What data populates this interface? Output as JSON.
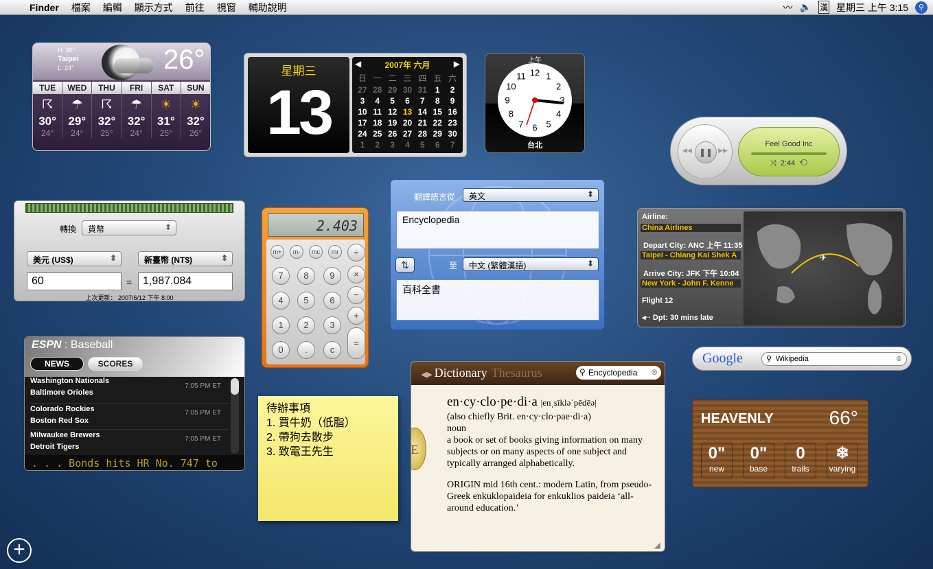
{
  "menubar": {
    "apple": "",
    "app": "Finder",
    "items": [
      "檔案",
      "編輯",
      "顯示方式",
      "前往",
      "視窗",
      "輔助說明"
    ],
    "ime": "漢",
    "clock": "星期三 上午 3:15"
  },
  "weather": {
    "high": "H: 30°",
    "city": "Taipei",
    "low": "L: 24°",
    "temp": "26°",
    "days": [
      {
        "name": "TUE",
        "hi": "30°",
        "lo": "24°",
        "icon": "thunderstorm-icon"
      },
      {
        "name": "WED",
        "hi": "29°",
        "lo": "24°",
        "icon": "rain-icon"
      },
      {
        "name": "THU",
        "hi": "32°",
        "lo": "25°",
        "icon": "thunderstorm-icon"
      },
      {
        "name": "FRI",
        "hi": "32°",
        "lo": "24°",
        "icon": "rain-icon"
      },
      {
        "name": "SAT",
        "hi": "31°",
        "lo": "25°",
        "icon": "partly-sunny-icon"
      },
      {
        "name": "SUN",
        "hi": "32°",
        "lo": "26°",
        "icon": "partly-sunny-icon"
      }
    ]
  },
  "calendar": {
    "weekday": "星期三",
    "day": "13",
    "month": "2007年 六月",
    "headers": [
      "日",
      "一",
      "二",
      "三",
      "四",
      "五",
      "六"
    ],
    "cells": [
      [
        "27",
        "o"
      ],
      [
        "28",
        "o"
      ],
      [
        "29",
        "o"
      ],
      [
        "30",
        "o"
      ],
      [
        "31",
        "o"
      ],
      [
        "1",
        "d"
      ],
      [
        "2",
        "d"
      ],
      [
        "3",
        "d"
      ],
      [
        "4",
        "d"
      ],
      [
        "5",
        "d"
      ],
      [
        "6",
        "d"
      ],
      [
        "7",
        "d"
      ],
      [
        "8",
        "d"
      ],
      [
        "9",
        "d"
      ],
      [
        "10",
        "d"
      ],
      [
        "11",
        "d"
      ],
      [
        "12",
        "d"
      ],
      [
        "13",
        "t"
      ],
      [
        "14",
        "d"
      ],
      [
        "15",
        "d"
      ],
      [
        "16",
        "d"
      ],
      [
        "17",
        "d"
      ],
      [
        "18",
        "d"
      ],
      [
        "19",
        "d"
      ],
      [
        "20",
        "d"
      ],
      [
        "21",
        "d"
      ],
      [
        "22",
        "d"
      ],
      [
        "23",
        "d"
      ],
      [
        "24",
        "d"
      ],
      [
        "25",
        "d"
      ],
      [
        "26",
        "d"
      ],
      [
        "27",
        "d"
      ],
      [
        "28",
        "d"
      ],
      [
        "29",
        "d"
      ],
      [
        "30",
        "d"
      ],
      [
        "1",
        "o"
      ],
      [
        "2",
        "o"
      ],
      [
        "3",
        "o"
      ],
      [
        "4",
        "o"
      ],
      [
        "5",
        "o"
      ],
      [
        "6",
        "o"
      ],
      [
        "7",
        "o"
      ]
    ]
  },
  "clock": {
    "ampm": "上午",
    "city": "台北",
    "numbers": [
      "12",
      "1",
      "2",
      "3",
      "4",
      "5",
      "6",
      "7",
      "8",
      "9",
      "10",
      "11"
    ]
  },
  "itunes": {
    "song": "Feel Good Inc",
    "time": "2:44"
  },
  "converter": {
    "type_label": "轉換",
    "type": "貨幣",
    "from": "美元 (US$)",
    "to": "新臺幣 (NT$)",
    "from_value": "60",
    "equals": "=",
    "to_value": "1,987.084",
    "updated": "上次更新： 2007/6/12 下午 8:00"
  },
  "calculator": {
    "display": "2.403",
    "keys": [
      "m+",
      "m-",
      "mc",
      "mr",
      "÷",
      "7",
      "8",
      "9",
      "×",
      "4",
      "5",
      "6",
      "−",
      "1",
      "2",
      "3",
      "+",
      "0",
      ".",
      "c",
      "="
    ]
  },
  "translator": {
    "from_label": "翻譯語言從",
    "from_lang": "英文",
    "input": "Encyclopedia",
    "to_label": "至",
    "to_lang": "中文 (繁體漢語)",
    "output": "百科全書"
  },
  "flight": {
    "airline_label": "Airline:",
    "airline": "China Airlines",
    "depart_label": "Depart City: ANC 上午 11:35",
    "depart": "Taipei - Chiang Kai Shek A",
    "arrive_label": "Arrive City:  JFK 下午 10:04",
    "arrive": "New York - John F. Kenne",
    "flight_no": "Flight 12",
    "status": "Dpt: 30 mins late"
  },
  "google": {
    "logo": "Google",
    "query": "Wikipedia"
  },
  "ski": {
    "name": "HEAVENLY",
    "temp": "66°",
    "tiles": [
      {
        "value": "0\"",
        "label": "new",
        "color": "#2e9a1e"
      },
      {
        "value": "0\"",
        "label": "base",
        "color": "#2258c8"
      },
      {
        "value": "0",
        "label": "trails",
        "color": "#7a2aa8"
      },
      {
        "value": "❄",
        "label": "varying",
        "color": "#d41414"
      }
    ]
  },
  "espn": {
    "brand": "ESPN",
    "sport": "Baseball",
    "tab_news": "NEWS",
    "tab_scores": "SCORES",
    "games": [
      {
        "a": "Washington Nationals",
        "b": "Baltimore Orioles",
        "time": "7:05 PM ET"
      },
      {
        "a": "Colorado Rockies",
        "b": "Boston Red Sox",
        "time": "7:05 PM ET"
      },
      {
        "a": "Milwaukee Brewers",
        "b": "Detroit Tigers",
        "time": "7:05 PM ET"
      }
    ],
    "ticker": ". . . Bonds hits HR No. 747 to"
  },
  "sticky": {
    "lines": [
      "待辦事項",
      "1. 買牛奶（低脂）",
      "2. 帶狗去散步",
      "3. 致電王先生"
    ]
  },
  "dictionary": {
    "tab1": "Dictionary",
    "tab2": "Thesaurus",
    "query": "Encyclopedia",
    "headword": "en·cy·clo·pe·di·a",
    "pron": "|enˌsīkləˈpēdēə|",
    "alt": "(also chiefly Brit. en·cy·clo·pae·di·a)",
    "pos": "noun",
    "def": "a book or set of books giving information on many subjects or on many aspects of one subject and typically arranged alphabetically.",
    "origin": "ORIGIN mid 16th cent.: modern Latin, from pseudo-Greek enkuklopaideia for enkuklios paideia ‘all-around education.’",
    "seal": "E"
  },
  "dock": {
    "add": "+"
  }
}
